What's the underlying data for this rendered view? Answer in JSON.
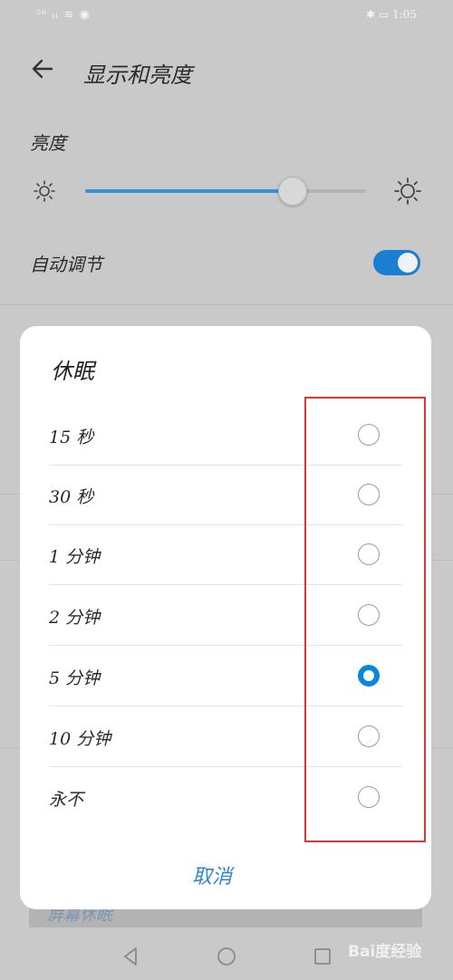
{
  "status_bar": {
    "left": "⁵⁶ ᵢₗ ≋ ◉",
    "right": "✱ ▭ 1:05"
  },
  "header": {
    "title": "显示和亮度"
  },
  "brightness": {
    "label": "亮度",
    "level": 0.74
  },
  "auto_adjust": {
    "label": "自动调节",
    "enabled": true
  },
  "background_item": {
    "label": "屏幕休眠"
  },
  "dialog": {
    "title": "休眠",
    "options": [
      {
        "label": "15 秒",
        "selected": false
      },
      {
        "label": "30 秒",
        "selected": false
      },
      {
        "label": "1 分钟",
        "selected": false
      },
      {
        "label": "2 分钟",
        "selected": false
      },
      {
        "label": "5 分钟",
        "selected": true
      },
      {
        "label": "10 分钟",
        "selected": false
      },
      {
        "label": "永不",
        "selected": false
      }
    ],
    "cancel_label": "取消"
  },
  "watermark": "Bai度经验",
  "colors": {
    "accent": "#0b86e0",
    "toggle": "#1b7fd1",
    "highlight": "#d23a3a"
  }
}
